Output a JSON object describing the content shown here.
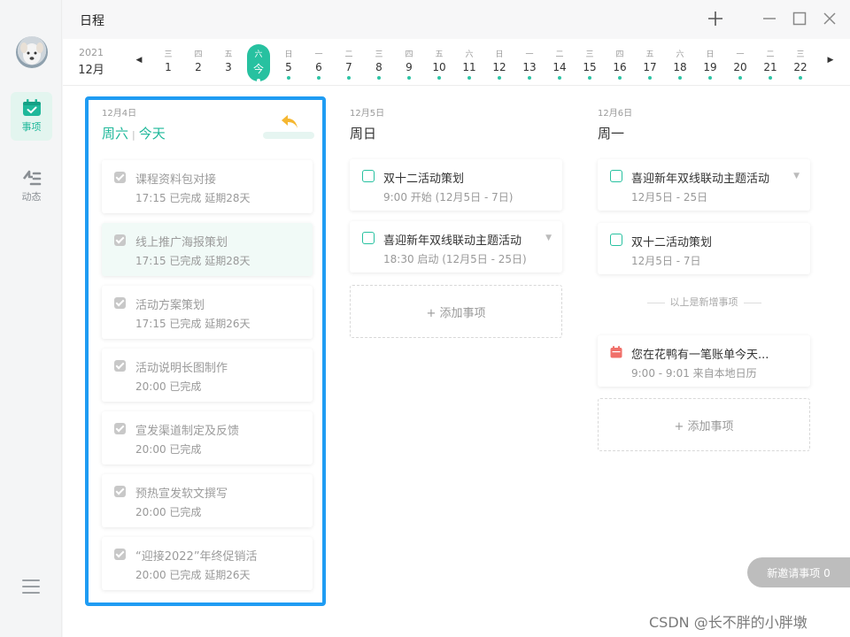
{
  "window": {
    "title": "日程"
  },
  "sidebar": {
    "items": [
      {
        "label": "事项",
        "icon": "calendar-check-icon",
        "active": true
      },
      {
        "label": "动态",
        "icon": "activity-icon",
        "active": false
      }
    ]
  },
  "datestrip": {
    "year": "2021",
    "month": "12月",
    "today_index": 3,
    "days": [
      {
        "wd": "三",
        "d": "1",
        "dot": false
      },
      {
        "wd": "四",
        "d": "2",
        "dot": false
      },
      {
        "wd": "五",
        "d": "3",
        "dot": false
      },
      {
        "wd": "六",
        "d": "今",
        "dot": true
      },
      {
        "wd": "日",
        "d": "5",
        "dot": true
      },
      {
        "wd": "一",
        "d": "6",
        "dot": true
      },
      {
        "wd": "二",
        "d": "7",
        "dot": true
      },
      {
        "wd": "三",
        "d": "8",
        "dot": true
      },
      {
        "wd": "四",
        "d": "9",
        "dot": true
      },
      {
        "wd": "五",
        "d": "10",
        "dot": true
      },
      {
        "wd": "六",
        "d": "11",
        "dot": true
      },
      {
        "wd": "日",
        "d": "12",
        "dot": true
      },
      {
        "wd": "一",
        "d": "13",
        "dot": true
      },
      {
        "wd": "二",
        "d": "14",
        "dot": true
      },
      {
        "wd": "三",
        "d": "15",
        "dot": true
      },
      {
        "wd": "四",
        "d": "16",
        "dot": true
      },
      {
        "wd": "五",
        "d": "17",
        "dot": true
      },
      {
        "wd": "六",
        "d": "18",
        "dot": true
      },
      {
        "wd": "日",
        "d": "19",
        "dot": true
      },
      {
        "wd": "一",
        "d": "20",
        "dot": true
      },
      {
        "wd": "二",
        "d": "21",
        "dot": true
      },
      {
        "wd": "三",
        "d": "22",
        "dot": true
      }
    ]
  },
  "columns": {
    "today": {
      "date": "12月4日",
      "weekday": "周六",
      "sep": "|",
      "label": "今天",
      "items": [
        {
          "title": "课程资料包对接",
          "sub": "17:15 已完成 延期28天"
        },
        {
          "title": "线上推广海报策划",
          "sub": "17:15 已完成 延期28天"
        },
        {
          "title": "活动方案策划",
          "sub": "17:15 已完成 延期26天"
        },
        {
          "title": "活动说明长图制作",
          "sub": "20:00 已完成"
        },
        {
          "title": "宣发渠道制定及反馈",
          "sub": "20:00 已完成"
        },
        {
          "title": "预热宣发软文撰写",
          "sub": "20:00 已完成"
        },
        {
          "title": "“迎接2022”年终促销活",
          "sub": "20:00 已完成 延期26天"
        }
      ]
    },
    "sunday": {
      "date": "12月5日",
      "weekday": "周日",
      "items": [
        {
          "title": "双十二活动策划",
          "sub": "9:00 开始 (12月5日 - 7日)"
        },
        {
          "title": "喜迎新年双线联动主题活动",
          "sub": "18:30 启动 (12月5日 - 25日)"
        }
      ],
      "add_label": "+ 添加事项"
    },
    "monday": {
      "date": "12月6日",
      "weekday": "周一",
      "items": [
        {
          "title": "喜迎新年双线联动主题活动",
          "sub": "12月5日 - 25日"
        },
        {
          "title": "双十二活动策划",
          "sub": "12月5日 - 7日"
        }
      ],
      "divider": "以上是新增事项",
      "bill": {
        "title": "您在花鸭有一笔账单今天...",
        "sub": "9:00 - 9:01 来自本地日历"
      },
      "add_label": "+ 添加事项"
    }
  },
  "invite": {
    "label": "新邀请事项 0"
  },
  "watermark": "CSDN @长不胖的小胖墩",
  "colors": {
    "accent": "#27c1a0",
    "highlight": "#1f9cf3",
    "return_icon": "#f5b731",
    "bill_icon": "#f0706a"
  }
}
